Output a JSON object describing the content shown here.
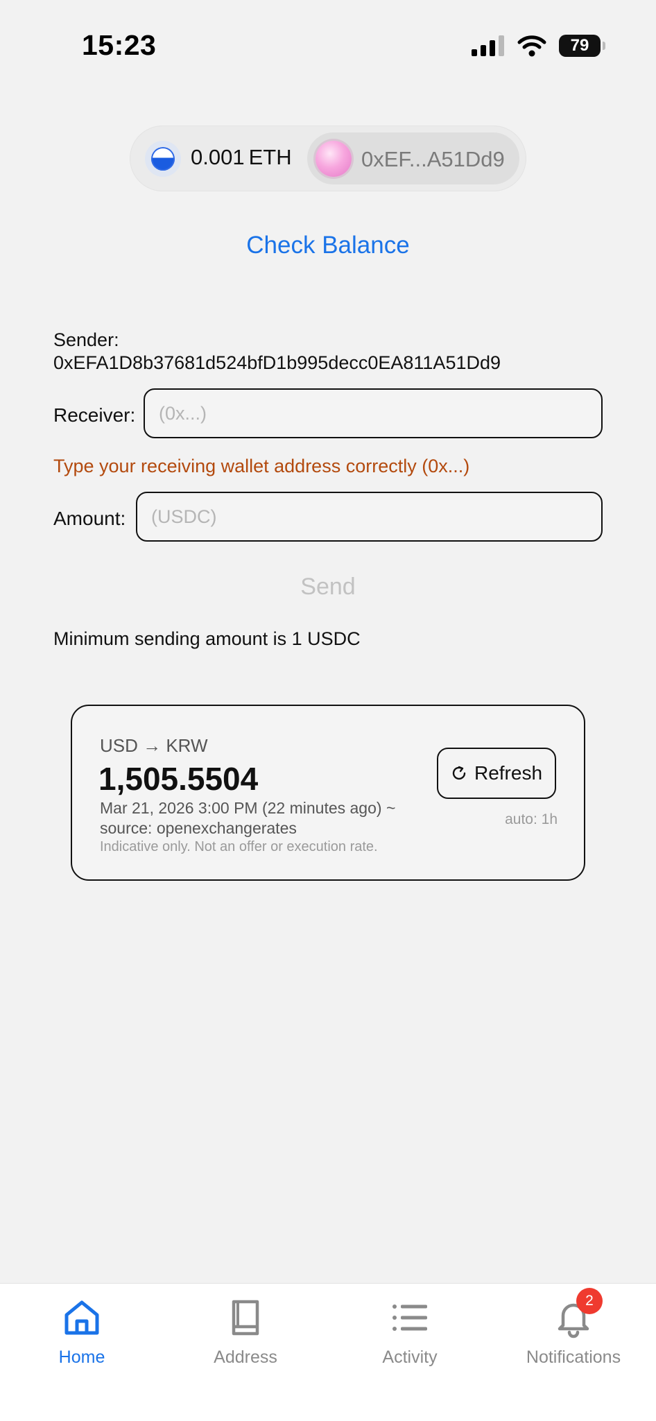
{
  "status_bar": {
    "time": "15:23",
    "battery": "79"
  },
  "wallet": {
    "balance_amount": "0.001",
    "balance_unit": "ETH",
    "address_short": "0xEF...A51Dd9"
  },
  "check_balance_label": "Check Balance",
  "sender": {
    "label": "Sender:",
    "address": "0xEFA1D8b37681d524bfD1b995decc0EA811A51Dd9"
  },
  "receiver": {
    "label": "Receiver:",
    "value": "",
    "placeholder": "(0x...)"
  },
  "error_message": "Type your receiving wallet address correctly (0x...)",
  "amount": {
    "label": "Amount:",
    "value": "",
    "placeholder": "(USDC)"
  },
  "send_label": "Send",
  "min_message": "Minimum sending amount is 1 USDC",
  "fx": {
    "pair": "USD → KRW",
    "rate": "1,505.5504",
    "timestamp": "Mar 21, 2026 3:00 PM (22 minutes ago) ~",
    "source": "source: openexchangerates",
    "disclaimer": "Indicative only. Not an offer or execution rate.",
    "refresh_label": "Refresh",
    "auto": "auto: 1h"
  },
  "tabs": [
    {
      "label": "Home",
      "icon": "home-icon",
      "active": true
    },
    {
      "label": "Address",
      "icon": "book-icon",
      "active": false
    },
    {
      "label": "Activity",
      "icon": "list-icon",
      "active": false
    },
    {
      "label": "Notifications",
      "icon": "bell-icon",
      "active": false,
      "badge": "2"
    }
  ],
  "colors": {
    "accent": "#1a73e8",
    "error": "#b34a0e",
    "badge": "#ef3a2f"
  }
}
